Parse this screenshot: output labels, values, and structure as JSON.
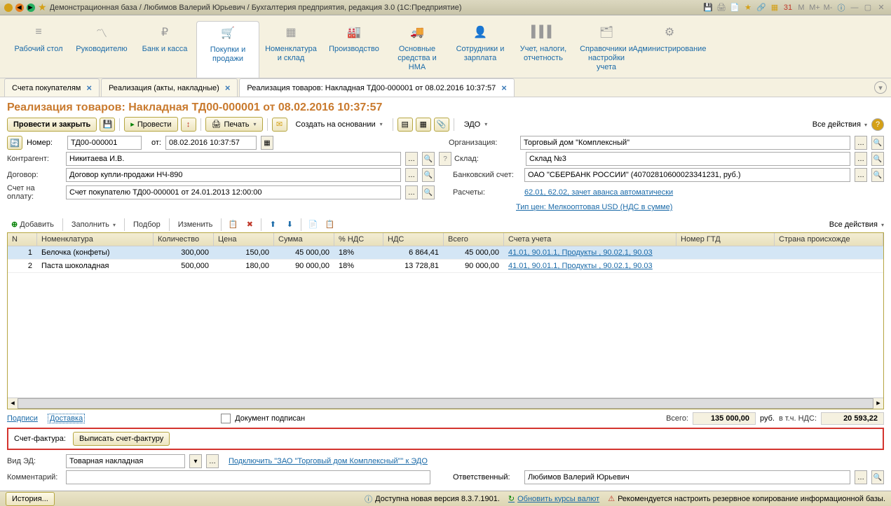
{
  "titlebar": {
    "title": "Демонстрационная база / Любимов Валерий Юрьевич / Бухгалтерия предприятия, редакция 3.0  (1С:Предприятие)",
    "m": "M",
    "mplus": "M+",
    "mminus": "M-"
  },
  "mainnav": {
    "items": [
      {
        "label": "Рабочий стол"
      },
      {
        "label": "Руководителю"
      },
      {
        "label": "Банк и касса"
      },
      {
        "label": "Покупки и продажи"
      },
      {
        "label": "Номенклатура и склад"
      },
      {
        "label": "Производство"
      },
      {
        "label": "Основные средства и НМА"
      },
      {
        "label": "Сотрудники и зарплата"
      },
      {
        "label": "Учет, налоги, отчетность"
      },
      {
        "label": "Справочники и настройки учета"
      },
      {
        "label": "Администрирование"
      }
    ]
  },
  "tabs": [
    {
      "label": "Счета покупателям"
    },
    {
      "label": "Реализация (акты, накладные)"
    },
    {
      "label": "Реализация товаров: Накладная ТД00-000001 от 08.02.2016 10:37:57"
    }
  ],
  "page": {
    "title": "Реализация товаров: Накладная ТД00-000001 от 08.02.2016 10:37:57"
  },
  "actions": {
    "post_close": "Провести и закрыть",
    "post": "Провести",
    "print": "Печать",
    "create_base": "Создать на основании",
    "edo": "ЭДО",
    "all_actions": "Все действия"
  },
  "form": {
    "number_label": "Номер:",
    "number": "ТД00-000001",
    "from_label": "от:",
    "date": "08.02.2016 10:37:57",
    "org_label": "Организация:",
    "org": "Торговый дом \"Комплексный\"",
    "counter_label": "Контрагент:",
    "counter": "Никитаева И.В.",
    "store_label": "Склад:",
    "store": "Склад №3",
    "contract_label": "Договор:",
    "contract": "Договор купли-продажи НЧ-890",
    "bank_label": "Банковский счет:",
    "bank": "ОАО \"СБЕРБАНК РОССИИ\" (40702810600023341231, руб.)",
    "invoice_label": "Счет на оплату:",
    "invoice": "Счет покупателю ТД00-000001 от 24.01.2013 12:00:00",
    "calc_label": "Расчеты:",
    "calc": "62.01, 62.02, зачет аванса автоматически",
    "price_type": "Тип цен: Мелкооптовая USD (НДС в сумме)"
  },
  "tbl_actions": {
    "add": "Добавить",
    "fill": "Заполнить",
    "select": "Подбор",
    "change": "Изменить",
    "all": "Все действия"
  },
  "grid": {
    "headers": {
      "n": "N",
      "nom": "Номенклатура",
      "qty": "Количество",
      "price": "Цена",
      "sum": "Сумма",
      "vat_pct": "% НДС",
      "vat": "НДС",
      "total": "Всего",
      "accounts": "Счета учета",
      "gtd": "Номер ГТД",
      "country": "Страна происхожде"
    },
    "rows": [
      {
        "n": "1",
        "nom": "Белочка (конфеты)",
        "qty": "300,000",
        "price": "150,00",
        "sum": "45 000,00",
        "vat_pct": "18%",
        "vat": "6 864,41",
        "total": "45 000,00",
        "accounts": "41.01, 90.01.1, Продукты , 90.02.1, 90.03"
      },
      {
        "n": "2",
        "nom": "Паста шоколадная",
        "qty": "500,000",
        "price": "180,00",
        "sum": "90 000,00",
        "vat_pct": "18%",
        "vat": "13 728,81",
        "total": "90 000,00",
        "accounts": "41.01, 90.01.1, Продукты , 90.02.1, 90.03"
      }
    ]
  },
  "footer": {
    "signatures": "Подписи",
    "delivery": "Доставка",
    "signed": "Документ подписан",
    "total_label": "Всего:",
    "total": "135 000,00",
    "rub": "руб.",
    "vat_label": "в т.ч. НДС:",
    "vat": "20 593,22",
    "sf_label": "Счет-фактура:",
    "sf_btn": "Выписать счет-фактуру",
    "ed_label": "Вид ЭД:",
    "ed_val": "Товарная накладная",
    "ed_link": "Подключить \"ЗАО \"Торговый дом Комплексный\"\" к ЭДО",
    "comment_label": "Комментарий:",
    "resp_label": "Ответственный:",
    "resp": "Любимов Валерий Юрьевич"
  },
  "status": {
    "history": "История...",
    "new_version": "Доступна новая версия 8.3.7.1901.",
    "rates": "Обновить курсы валют",
    "backup": "Рекомендуется настроить резервное копирование информационной базы."
  }
}
